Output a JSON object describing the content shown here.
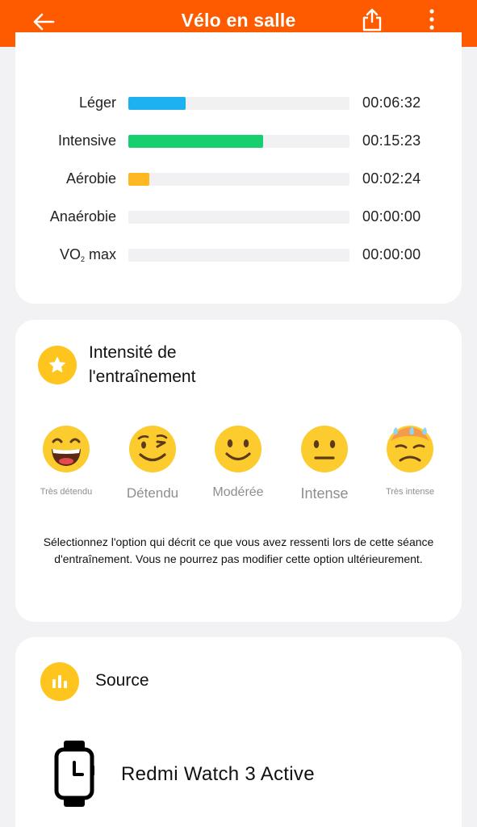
{
  "header": {
    "title": "Vélo en salle",
    "background": "#fe5a00",
    "back_icon": "arrow-left-icon",
    "share_icon": "share-icon",
    "more_icon": "more-vertical-icon"
  },
  "zones": [
    {
      "label": "Léger",
      "time": "00:06:32",
      "fraction": 0.26,
      "color": "#1db1f0"
    },
    {
      "label": "Intensive",
      "time": "00:15:23",
      "fraction": 0.61,
      "color": "#17cf6e"
    },
    {
      "label": "Aérobie",
      "time": "00:02:24",
      "fraction": 0.095,
      "color": "#fdb822"
    },
    {
      "label": "Anaérobie",
      "time": "00:00:00",
      "fraction": 0,
      "color": "#f44336"
    },
    {
      "label_main": "VO",
      "label_sub": "2",
      "label_suffix": " max",
      "time": "00:00:00",
      "fraction": 0,
      "color": "#8e44ad"
    }
  ],
  "intensity": {
    "title": "Intensité de l'entraînement",
    "icon": "star-icon",
    "options": [
      {
        "label": "Très détendu",
        "emoji": "grinning-face"
      },
      {
        "label": "Détendu",
        "emoji": "winking-face"
      },
      {
        "label": "Modérée",
        "emoji": "smiling-face"
      },
      {
        "label": "Intense",
        "emoji": "neutral-face"
      },
      {
        "label": "Très intense",
        "emoji": "exhausted-sweat-face"
      }
    ],
    "note": "Sélectionnez l'option qui décrit ce que vous avez ressenti lors de cette séance d'entraînement. Vous ne pourrez pas modifier cette option ultérieurement."
  },
  "source": {
    "title": "Source",
    "icon": "bar-chart-icon",
    "device_icon": "smartwatch-icon",
    "device_name": "Redmi Watch 3 Active"
  }
}
